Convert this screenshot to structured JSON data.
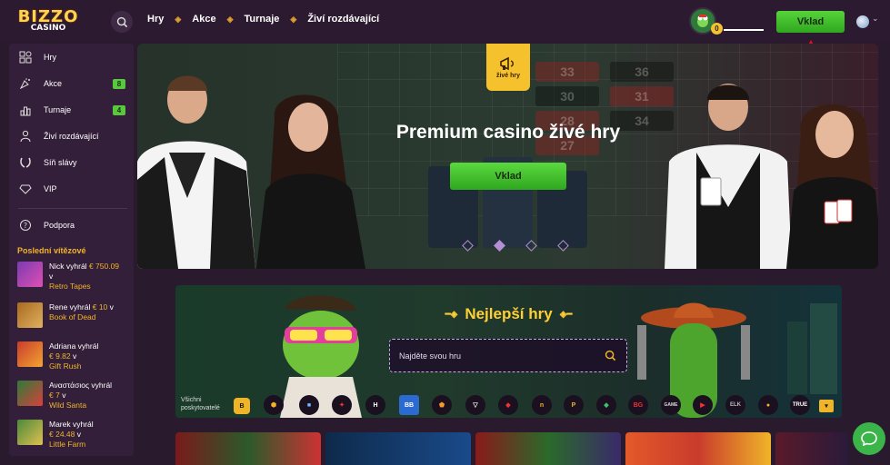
{
  "logo": {
    "line1": "BIZZO",
    "line2": "CASINO"
  },
  "nav": {
    "items": [
      "Hry",
      "Akce",
      "Turnaje",
      "Živí rozdávající"
    ]
  },
  "header": {
    "avatar_badge": "0",
    "deposit_label": "Vklad"
  },
  "sidebar": {
    "items": [
      {
        "label": "Hry",
        "icon": "games-icon"
      },
      {
        "label": "Akce",
        "icon": "promo-icon",
        "count": "8"
      },
      {
        "label": "Turnaje",
        "icon": "tournament-icon",
        "count": "4"
      },
      {
        "label": "Živí rozdávající",
        "icon": "live-dealer-icon"
      },
      {
        "label": "Síň slávy",
        "icon": "laurel-icon"
      },
      {
        "label": "VIP",
        "icon": "diamond-icon"
      }
    ],
    "support_label": "Podpora",
    "winners_title": "Poslední vítězové",
    "winners": [
      {
        "name": "Nick vyhrál",
        "amount": "€ 750.09",
        "suffix": "v",
        "game": "Retro Tapes",
        "color": "#7a3bb0"
      },
      {
        "name": "Rene vyhrál",
        "amount": "€ 10",
        "suffix": "v",
        "game": "Book of Dead",
        "color": "#a86a1e"
      },
      {
        "name": "Adriana vyhrál",
        "amount": "€ 9.82",
        "suffix": "v",
        "game": "Gift Rush",
        "color": "#c93b2c"
      },
      {
        "name": "Αναστάσιος vyhrál",
        "amount": "€ 7",
        "suffix": "v",
        "game": "Wild Santa",
        "color": "#2d7a3a"
      },
      {
        "name": "Marek vyhrál",
        "amount": "€ 24.48",
        "suffix": "v",
        "game": "Little Farm",
        "color": "#4a8a3a"
      }
    ]
  },
  "hero": {
    "badge_label": "živé hry",
    "title": "Premium casino živé hry",
    "cta_label": "Vklad",
    "table_numbers": [
      "33",
      "36",
      "30",
      "31",
      "28",
      "34",
      "27"
    ],
    "slides": 4,
    "active_slide": 2
  },
  "games": {
    "title": "Nejlepší hry",
    "search_placeholder": "Najděte svou hru",
    "providers_label_1": "Všichni",
    "providers_label_2": "poskytovatelé",
    "providers": [
      "B",
      "⬢",
      "■",
      "✦",
      "H",
      "BB",
      "⬟",
      "▽",
      "◆",
      "n",
      "P",
      "◆",
      "BG",
      "GAME",
      "▶",
      "ELK",
      "●",
      "TRUE"
    ]
  },
  "colors": {
    "accent_green": "#3fbf2a",
    "gold": "#f0b429",
    "bg": "#2a1a2e",
    "sidebar": "#341f3a"
  }
}
